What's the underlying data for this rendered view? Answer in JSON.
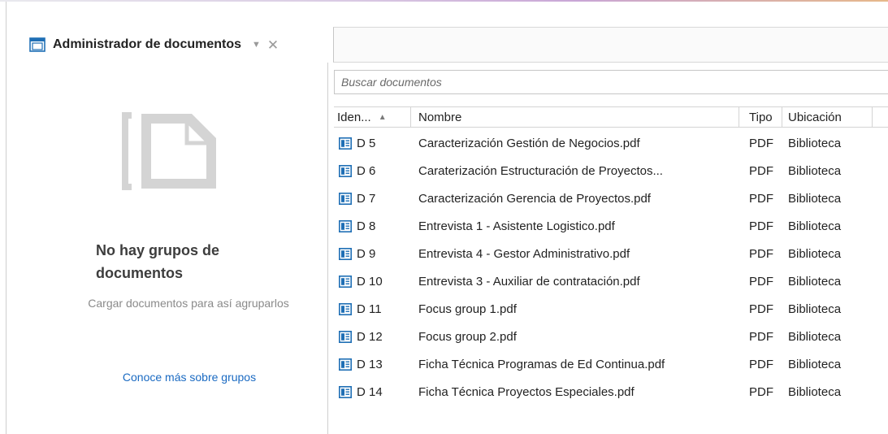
{
  "tab": {
    "title": "Administrador de documentos",
    "icon": "document-manager-icon",
    "chevron": "▼",
    "close": "✕"
  },
  "empty_state": {
    "title": "No hay grupos de documentos",
    "subtitle": "Cargar documentos para así agruparlos",
    "link": "Conoce más sobre grupos"
  },
  "search": {
    "placeholder": "Buscar documentos"
  },
  "table": {
    "columns": {
      "id": "Iden...",
      "name": "Nombre",
      "type": "Tipo",
      "location": "Ubicación"
    },
    "sort_indicator": "▲",
    "rows": [
      {
        "id": "D 5",
        "name": "Caracterización Gestión de Negocios.pdf",
        "type": "PDF",
        "location": "Biblioteca"
      },
      {
        "id": "D 6",
        "name": "Caraterización Estructuración de Proyectos...",
        "type": "PDF",
        "location": "Biblioteca"
      },
      {
        "id": "D 7",
        "name": "Caracterización Gerencia de Proyectos.pdf",
        "type": "PDF",
        "location": "Biblioteca"
      },
      {
        "id": "D 8",
        "name": "Entrevista 1 - Asistente Logistico.pdf",
        "type": "PDF",
        "location": "Biblioteca"
      },
      {
        "id": "D 9",
        "name": "Entrevista 4 - Gestor Administrativo.pdf",
        "type": "PDF",
        "location": "Biblioteca"
      },
      {
        "id": "D 10",
        "name": "Entrevista 3 - Auxiliar de contratación.pdf",
        "type": "PDF",
        "location": "Biblioteca"
      },
      {
        "id": "D 11",
        "name": "Focus group 1.pdf",
        "type": "PDF",
        "location": "Biblioteca"
      },
      {
        "id": "D 12",
        "name": "Focus group 2.pdf",
        "type": "PDF",
        "location": "Biblioteca"
      },
      {
        "id": "D 13",
        "name": "Ficha Técnica Programas de Ed Continua.pdf",
        "type": "PDF",
        "location": "Biblioteca"
      },
      {
        "id": "D 14",
        "name": "Ficha Técnica Proyectos Especiales.pdf",
        "type": "PDF",
        "location": "Biblioteca"
      }
    ]
  },
  "colors": {
    "link": "#1a6ac2",
    "icon_blue": "#1f6fb5",
    "muted_text": "#8a8a8a",
    "placeholder_art": "#d4d4d4"
  }
}
